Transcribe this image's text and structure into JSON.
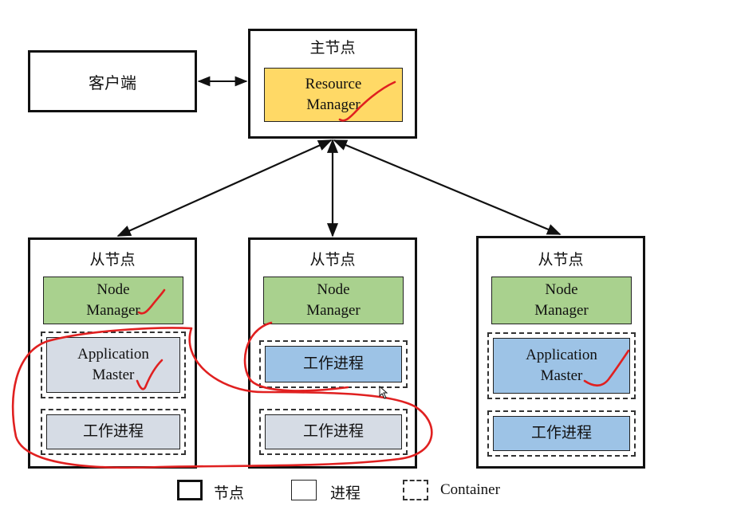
{
  "client": "客户端",
  "master": {
    "title": "主节点",
    "rm_line1": "Resource",
    "rm_line2": "Manager"
  },
  "slaves": [
    {
      "title": "从节点",
      "nm_line1": "Node",
      "nm_line2": "Manager",
      "am_line1": "Application",
      "am_line2": "Master",
      "worker": "工作进程"
    },
    {
      "title": "从节点",
      "nm_line1": "Node",
      "nm_line2": "Manager",
      "worker_top": "工作进程",
      "worker": "工作进程"
    },
    {
      "title": "从节点",
      "nm_line1": "Node",
      "nm_line2": "Manager",
      "am_line1": "Application",
      "am_line2": "Master",
      "worker": "工作进程"
    }
  ],
  "legend": {
    "node": "节点",
    "process": "进程",
    "container": "Container"
  },
  "colors": {
    "node_manager": "#a9d18e",
    "resource_manager": "#ffd966",
    "blue_process": "#9dc3e6",
    "grey_process": "#d6dce5",
    "annotation": "#e02020"
  }
}
